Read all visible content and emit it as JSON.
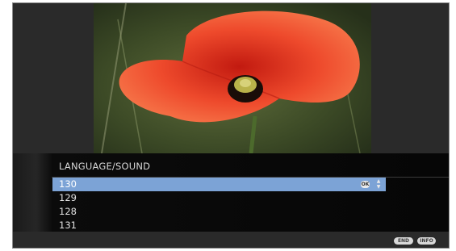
{
  "menu": {
    "title": "LANGUAGE/SOUND",
    "items": [
      "130",
      "129",
      "128",
      "131"
    ]
  },
  "icons": {
    "ok": "OK",
    "end": "END",
    "info": "INFO"
  },
  "colors": {
    "selection": "#7ca3d6",
    "background": "#2a2a2a",
    "poppy": "#e2402a"
  }
}
